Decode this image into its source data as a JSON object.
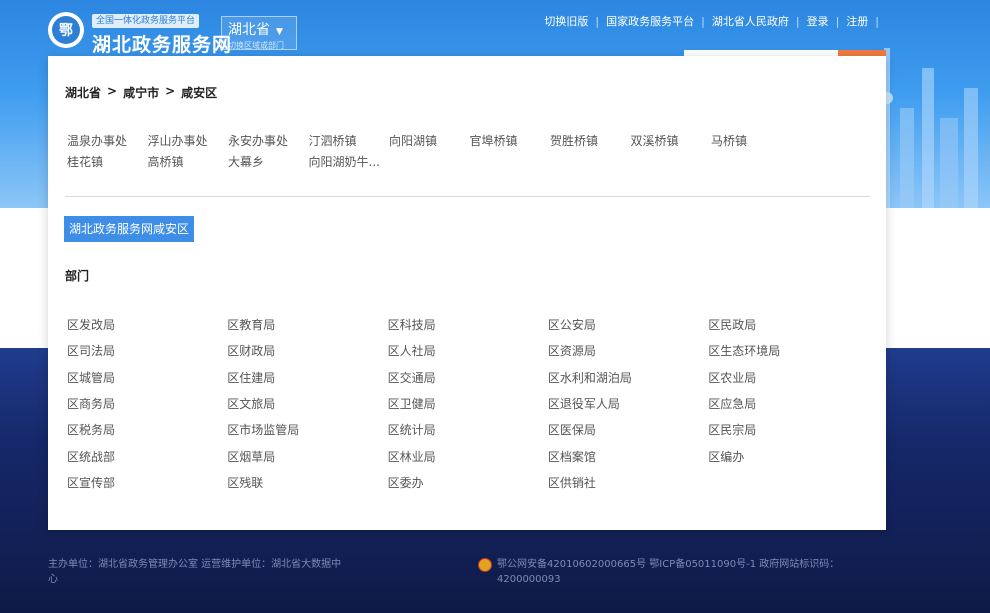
{
  "header": {
    "platform_tag": "全国一体化政务服务平台",
    "site_title": "湖北政务服务网",
    "region_name": "湖北省",
    "region_hint": "切换区域或部门",
    "top_links": [
      "切换旧版",
      "国家政务服务平台",
      "湖北省人民政府",
      "登录",
      "注册"
    ]
  },
  "breadcrumb": [
    "湖北省",
    "咸宁市",
    "咸安区"
  ],
  "towns": [
    "温泉办事处",
    "浮山办事处",
    "永安办事处",
    "汀泗桥镇",
    "向阳湖镇",
    "官埠桥镇",
    "贺胜桥镇",
    "双溪桥镇",
    "马桥镇",
    "桂花镇",
    "高桥镇",
    "大幕乡",
    "向阳湖奶牛..."
  ],
  "site_button": "湖北政务服务网咸安区",
  "dept_title": "部门",
  "departments": [
    "区发改局",
    "区教育局",
    "区科技局",
    "区公安局",
    "区民政局",
    "区司法局",
    "区财政局",
    "区人社局",
    "区资源局",
    "区生态环境局",
    "区城管局",
    "区住建局",
    "区交通局",
    "区水利和湖泊局",
    "区农业局",
    "区商务局",
    "区文旅局",
    "区卫健局",
    "区退役军人局",
    "区应急局",
    "区税务局",
    "区市场监管局",
    "区统计局",
    "区医保局",
    "区民宗局",
    "区统战部",
    "区烟草局",
    "区林业局",
    "区档案馆",
    "区编办",
    "区宣传部",
    "区残联",
    "区委办",
    "区供销社"
  ],
  "footer": {
    "left": "主办单位：湖北省政务管理办公室 运营维护单位：湖北省大数据中心",
    "right": "鄂公网安备42010602000665号 鄂ICP备05011090号-1 政府网站标识码：4200000093"
  },
  "colors": {
    "primary_blue": "#3e8ee8",
    "accent_orange": "#f07b3f",
    "footer_bg": "#16286a"
  }
}
